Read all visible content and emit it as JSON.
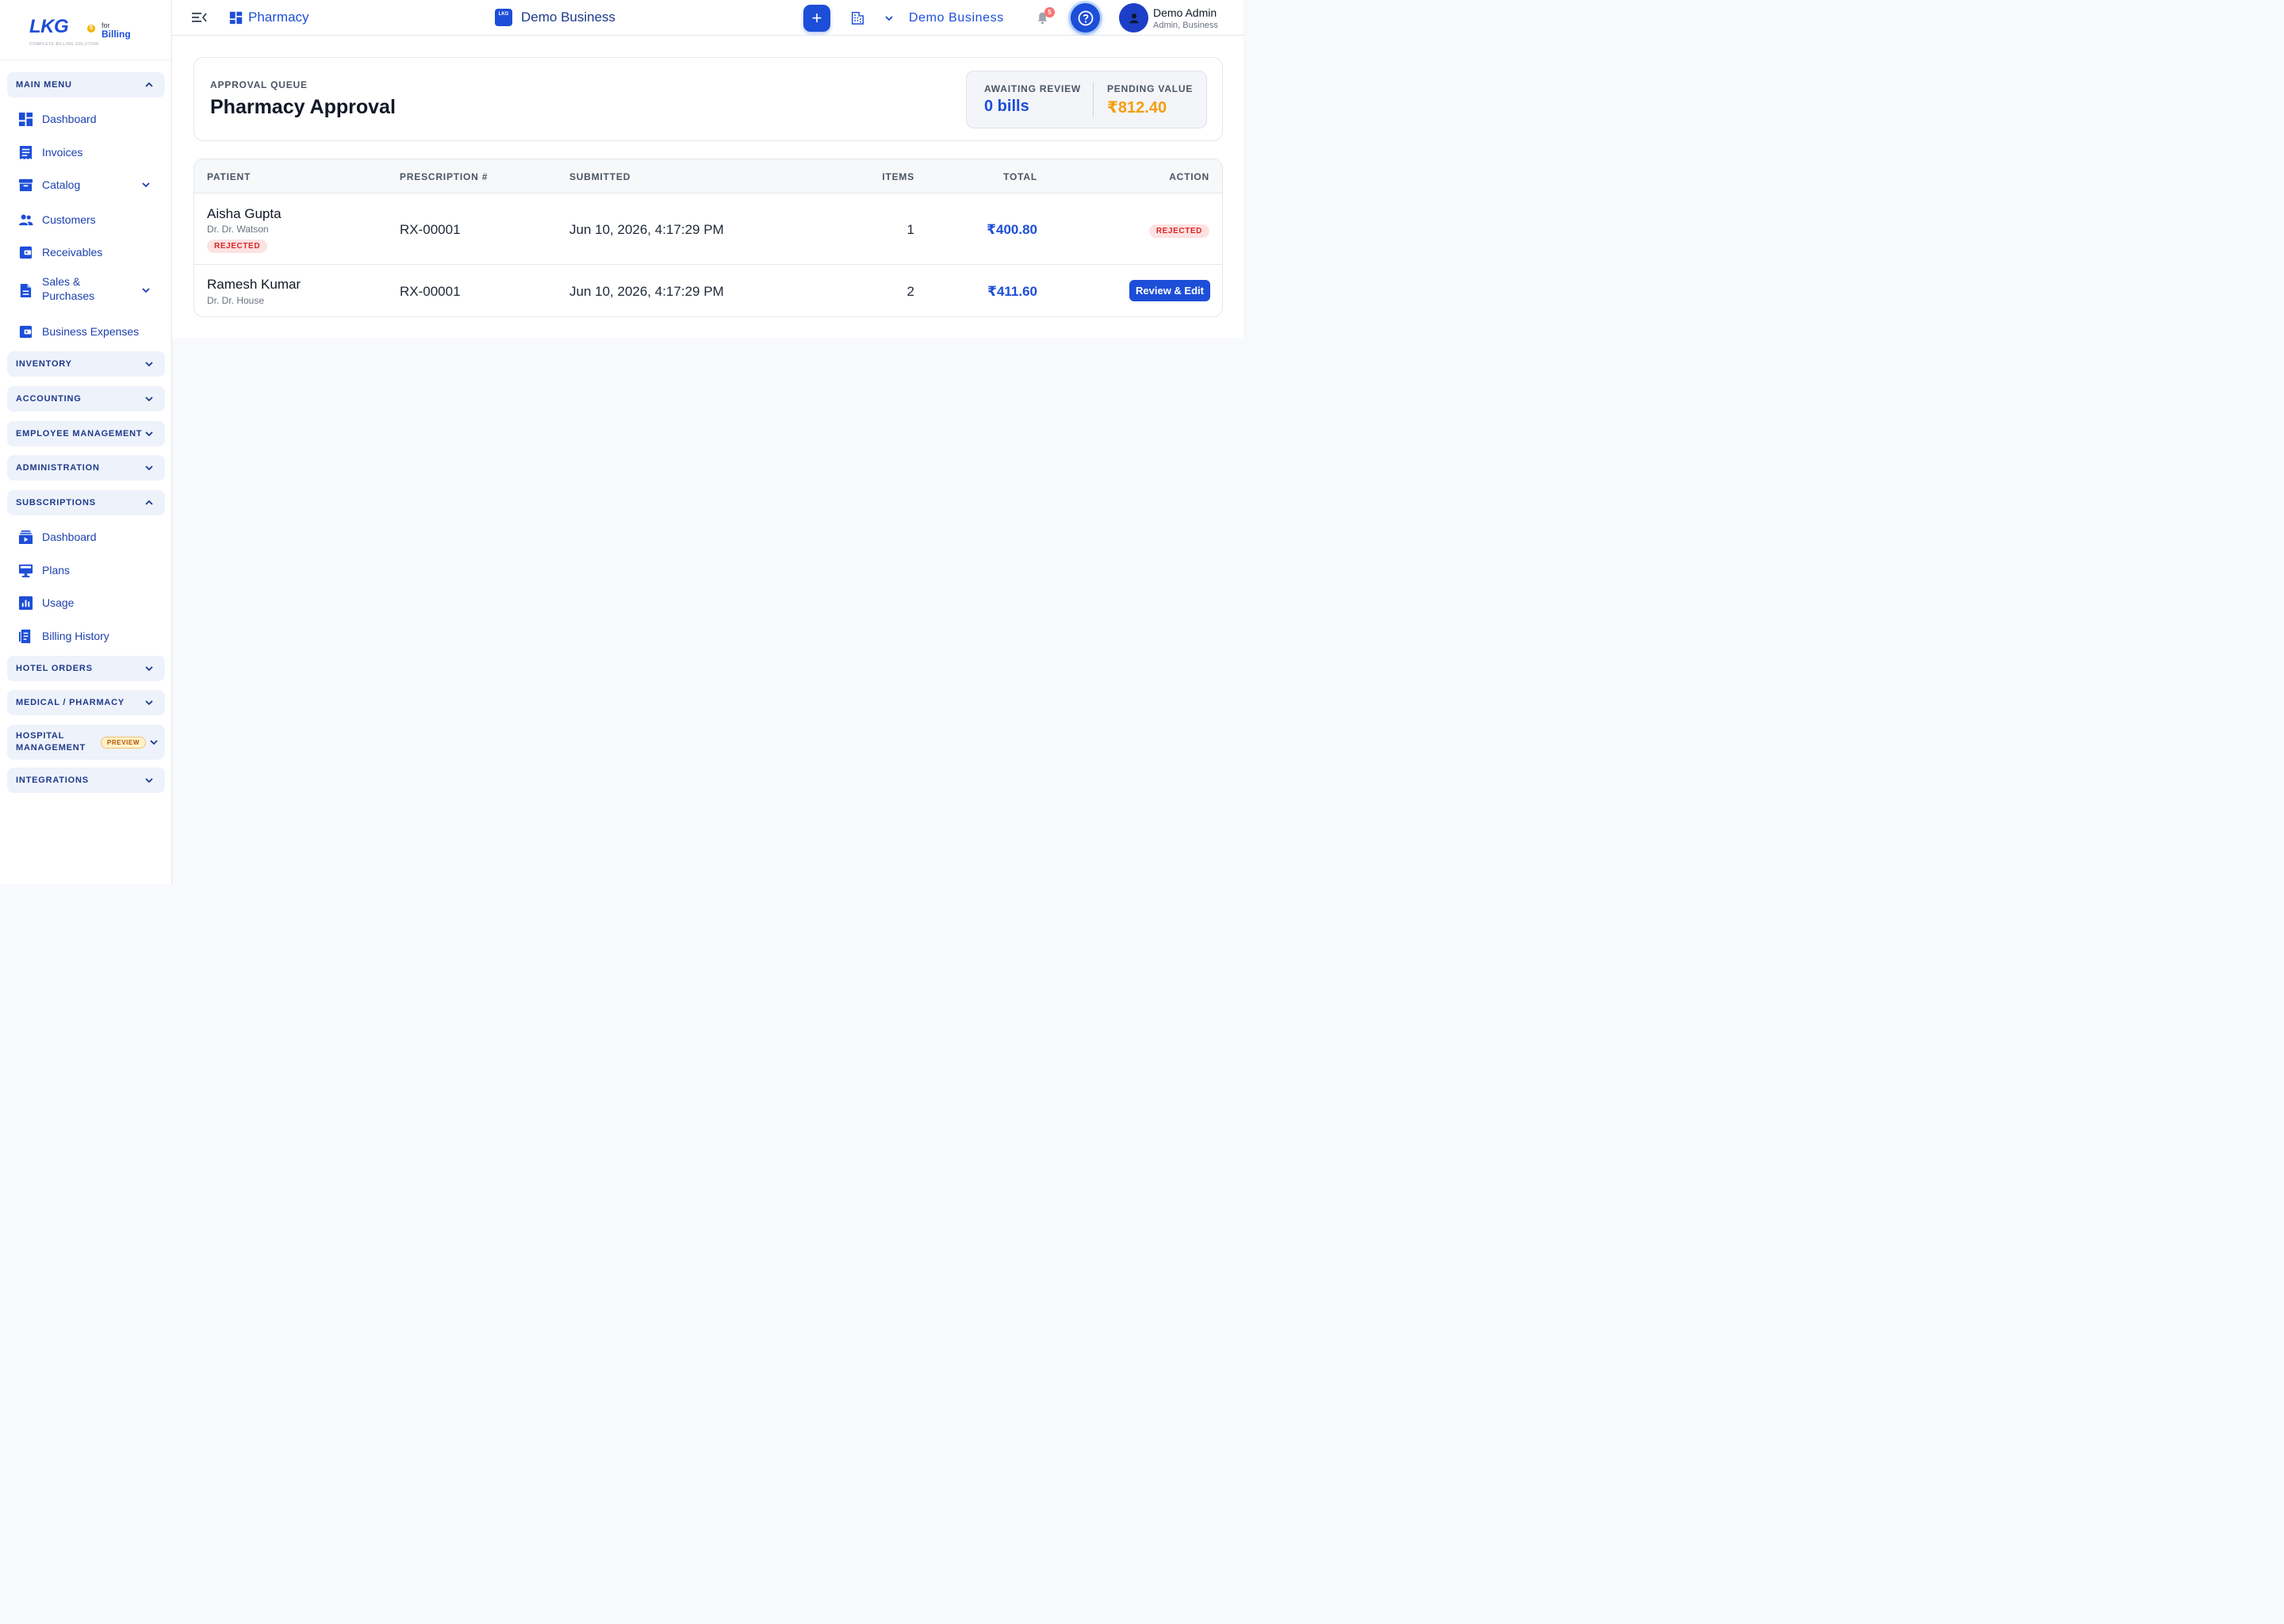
{
  "brand": {
    "logo_text": "LKG",
    "coin_symbol": "$",
    "for_text": "for",
    "billing_text": "Billing",
    "tagline": "COMPLETE BILLING SOLUTION"
  },
  "sidebar": {
    "main_menu": "MAIN MENU",
    "main_items": [
      "Dashboard",
      "Invoices",
      "Catalog",
      "Customers",
      "Receivables",
      "Sales &",
      "Purchases",
      "Business Expenses"
    ],
    "inventory": "INVENTORY",
    "accounting": "ACCOUNTING",
    "employee_management": "EMPLOYEE MANAGEMENT",
    "administration": "ADMINISTRATION",
    "subscriptions": "SUBSCRIPTIONS",
    "subscription_items": [
      "Dashboard",
      "Plans",
      "Usage",
      "Billing History"
    ],
    "hotel_orders": "HOTEL ORDERS",
    "medical_pharmacy": "MEDICAL / PHARMACY",
    "hospital_line1": "HOSPITAL",
    "hospital_line2": "MANAGEMENT",
    "preview_badge": "PREVIEW",
    "integrations": "INTEGRATIONS"
  },
  "header": {
    "module": "Pharmacy",
    "business_badge": "LKG",
    "business_title": "Demo Business",
    "plus": "+",
    "business_selector": "Demo Business",
    "notification_count": "5",
    "user_name": "Demo Admin",
    "user_role": "Admin, Business"
  },
  "page": {
    "eyebrow": "APPROVAL QUEUE",
    "title": "Pharmacy Approval",
    "stats": {
      "awaiting_label": "AWAITING REVIEW",
      "awaiting_value": "0 bills",
      "pending_label": "PENDING VALUE",
      "pending_value": "₹812.40"
    }
  },
  "table": {
    "headers": [
      "PATIENT",
      "PRESCRIPTION #",
      "SUBMITTED",
      "ITEMS",
      "TOTAL",
      "ACTION"
    ],
    "rows": [
      {
        "patient": "Aisha Gupta",
        "doctor": "Dr. Dr. Watson",
        "status": "REJECTED",
        "prescription": "RX-00001",
        "submitted": "Jun 10, 2026, 4:17:29 PM",
        "items": "1",
        "total": "₹400.80",
        "action": "REJECTED"
      },
      {
        "patient": "Ramesh Kumar",
        "doctor": "Dr. Dr. House",
        "prescription": "RX-00001",
        "submitted": "Jun 10, 2026, 4:17:29 PM",
        "items": "2",
        "total": "₹411.60",
        "action": "Review & Edit"
      }
    ]
  },
  "colors": {
    "primary": "#1d4ed8",
    "pending_value": "#f59e0b",
    "rejected": "#dc2626"
  },
  "icons": {
    "sidebar_toggle": "menu-collapse-icon",
    "module": "grid-dashboard-icon",
    "building": "building-icon",
    "bell": "bell-icon",
    "help": "help-circle-icon",
    "avatar": "user-icon"
  }
}
